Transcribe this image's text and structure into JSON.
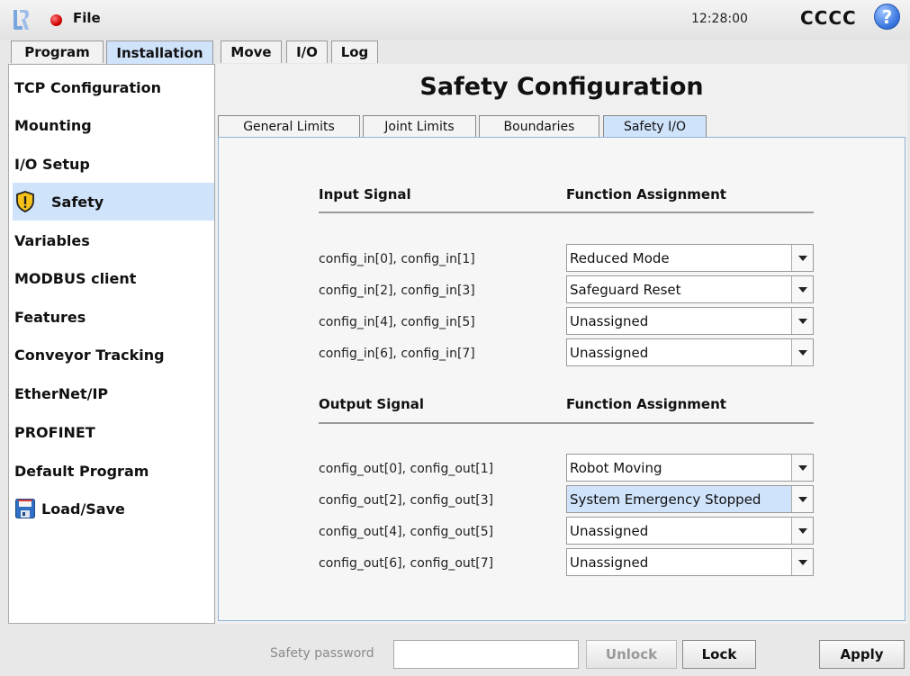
{
  "topbar": {
    "file_label": "File",
    "time": "12:28:00",
    "robot_name": "CCCC",
    "help_glyph": "?"
  },
  "main_tabs": [
    {
      "label": "Program",
      "active": false
    },
    {
      "label": "Installation",
      "active": true
    },
    {
      "label": "Move",
      "active": false
    },
    {
      "label": "I/O",
      "active": false
    },
    {
      "label": "Log",
      "active": false
    }
  ],
  "sidebar": {
    "items": [
      {
        "label": "TCP Configuration"
      },
      {
        "label": "Mounting"
      },
      {
        "label": "I/O Setup"
      },
      {
        "label": "Safety",
        "selected": true,
        "icon": "warning-shield-icon"
      },
      {
        "label": "Variables"
      },
      {
        "label": "MODBUS client"
      },
      {
        "label": "Features"
      },
      {
        "label": "Conveyor Tracking"
      },
      {
        "label": "EtherNet/IP"
      },
      {
        "label": "PROFINET"
      },
      {
        "label": "Default Program"
      },
      {
        "label": "Load/Save",
        "icon": "floppy-disk-icon"
      }
    ]
  },
  "page": {
    "title": "Safety Configuration",
    "tabs": [
      {
        "label": "General Limits"
      },
      {
        "label": "Joint Limits"
      },
      {
        "label": "Boundaries"
      },
      {
        "label": "Safety I/O",
        "active": true
      }
    ]
  },
  "safety_io": {
    "input_header": "Input Signal",
    "output_header": "Output Signal",
    "function_header": "Function Assignment",
    "inputs": [
      {
        "signal": "config_in[0], config_in[1]",
        "value": "Reduced Mode"
      },
      {
        "signal": "config_in[2], config_in[3]",
        "value": "Safeguard Reset"
      },
      {
        "signal": "config_in[4], config_in[5]",
        "value": "Unassigned"
      },
      {
        "signal": "config_in[6], config_in[7]",
        "value": "Unassigned"
      }
    ],
    "outputs": [
      {
        "signal": "config_out[0], config_out[1]",
        "value": "Robot Moving"
      },
      {
        "signal": "config_out[2], config_out[3]",
        "value": "System Emergency Stopped",
        "highlighted": true
      },
      {
        "signal": "config_out[4], config_out[5]",
        "value": "Unassigned"
      },
      {
        "signal": "config_out[6], config_out[7]",
        "value": "Unassigned"
      }
    ]
  },
  "bottom": {
    "password_label": "Safety password",
    "password_value": "",
    "unlock_label": "Unlock",
    "lock_label": "Lock",
    "apply_label": "Apply"
  },
  "colors": {
    "selection": "#cfe3fb",
    "panel_border": "#8fb2d8",
    "status_dot": "#d00000",
    "help_blue": "#3a78e0"
  }
}
